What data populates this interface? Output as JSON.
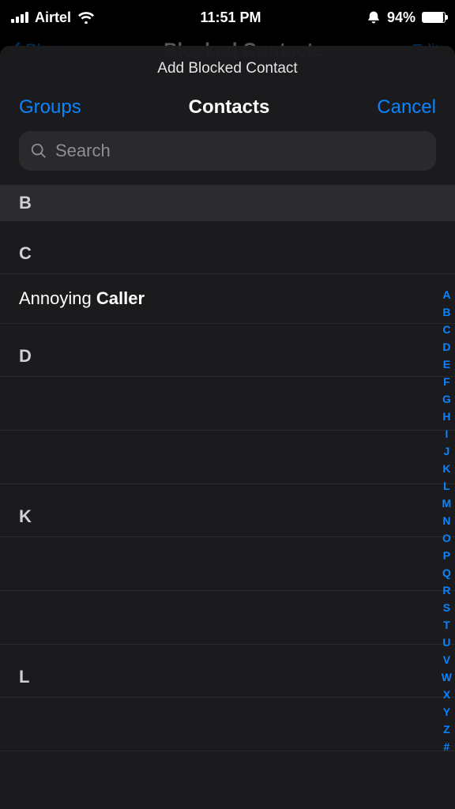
{
  "status_bar": {
    "carrier": "Airtel",
    "time": "11:51 PM",
    "battery_pct": "94%",
    "battery_fill_pct": 94
  },
  "background_screen": {
    "back_label": "Phone",
    "title": "Blocked Contacts",
    "edit_label": "Edit"
  },
  "sheet": {
    "title": "Add Blocked Contact",
    "left_action": "Groups",
    "center_title": "Contacts",
    "right_action": "Cancel",
    "search_placeholder": "Search"
  },
  "sections": {
    "sticky_letter": "B",
    "groups": [
      {
        "letter": "C",
        "contacts": [
          {
            "first": "Annoying",
            "last": "Caller"
          }
        ]
      },
      {
        "letter": "D",
        "contacts": [
          {},
          {}
        ]
      },
      {
        "letter": "K",
        "contacts": [
          {},
          {}
        ]
      },
      {
        "letter": "L",
        "contacts": [
          {}
        ]
      }
    ]
  },
  "alpha_index": [
    "A",
    "B",
    "C",
    "D",
    "E",
    "F",
    "G",
    "H",
    "I",
    "J",
    "K",
    "L",
    "M",
    "N",
    "O",
    "P",
    "Q",
    "R",
    "S",
    "T",
    "U",
    "V",
    "W",
    "X",
    "Y",
    "Z",
    "#"
  ]
}
